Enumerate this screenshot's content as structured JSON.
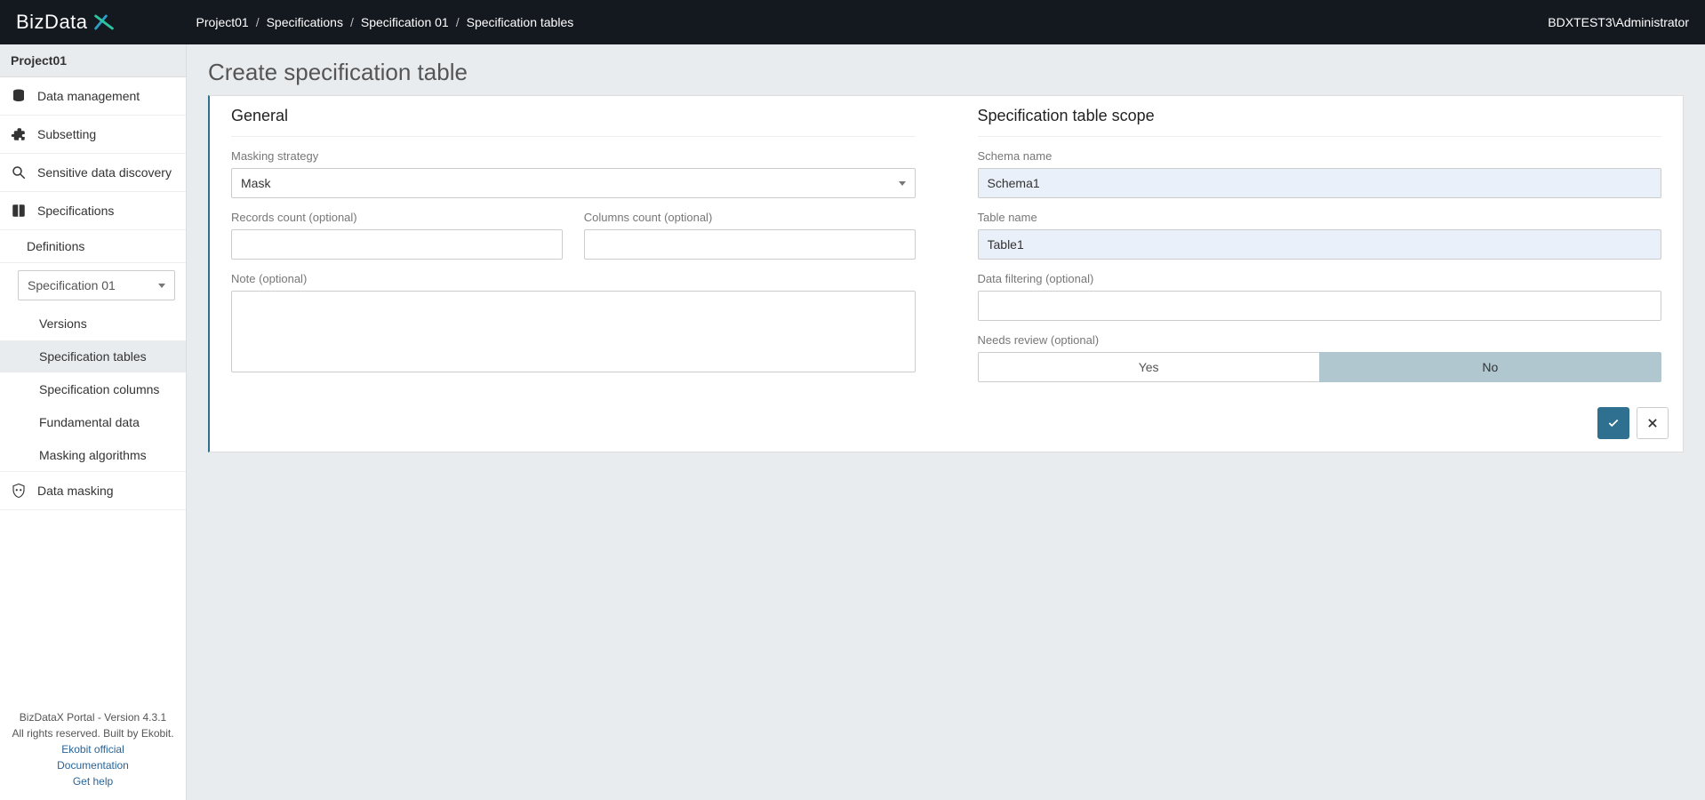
{
  "brand": "BizData",
  "breadcrumb": [
    "Project01",
    "Specifications",
    "Specification 01",
    "Specification tables"
  ],
  "user": "BDXTEST3\\Administrator",
  "sidebar": {
    "project": "Project01",
    "items": [
      {
        "label": "Data management"
      },
      {
        "label": "Subsetting"
      },
      {
        "label": "Sensitive data discovery"
      },
      {
        "label": "Specifications"
      }
    ],
    "definitions_label": "Definitions",
    "spec_select": "Specification 01",
    "spec_children": [
      {
        "label": "Versions"
      },
      {
        "label": "Specification tables",
        "active": true
      },
      {
        "label": "Specification columns"
      },
      {
        "label": "Fundamental data"
      },
      {
        "label": "Masking algorithms"
      }
    ],
    "data_masking": "Data masking"
  },
  "footer": {
    "line1": "BizDataX Portal - Version 4.3.1",
    "line2": "All rights reserved. Built by Ekobit.",
    "link1": "Ekobit official",
    "link2": "Documentation",
    "link3": "Get help"
  },
  "page_title": "Create specification table",
  "general": {
    "title": "General",
    "masking_strategy_label": "Masking strategy",
    "masking_strategy_value": "Mask",
    "records_count_label": "Records count (optional)",
    "records_count_value": "",
    "columns_count_label": "Columns count (optional)",
    "columns_count_value": "",
    "note_label": "Note (optional)",
    "note_value": ""
  },
  "scope": {
    "title": "Specification table scope",
    "schema_label": "Schema name",
    "schema_value": "Schema1",
    "table_label": "Table name",
    "table_value": "Table1",
    "filter_label": "Data filtering (optional)",
    "filter_value": "",
    "review_label": "Needs review (optional)",
    "review_yes": "Yes",
    "review_no": "No",
    "review_selected": "No"
  }
}
